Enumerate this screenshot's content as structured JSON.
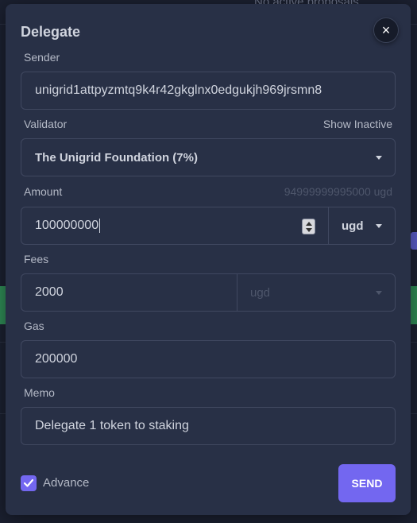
{
  "background": {
    "proposals_text": "No active proposals"
  },
  "modal": {
    "title": "Delegate",
    "close_glyph": "×",
    "sender": {
      "label": "Sender",
      "value": "unigrid1attpyzmtq9k4r42gkglnx0edgukjh969jrsmn8"
    },
    "validator": {
      "label": "Validator",
      "show_inactive": "Show Inactive",
      "selected": "The Unigrid Foundation (7%)"
    },
    "amount": {
      "label": "Amount",
      "balance": "94999999995000 ugd",
      "value": "100000000",
      "unit": "ugd"
    },
    "fees": {
      "label": "Fees",
      "value": "2000",
      "unit": "ugd"
    },
    "gas": {
      "label": "Gas",
      "value": "200000"
    },
    "memo": {
      "label": "Memo",
      "value": "Delegate 1 token to staking"
    },
    "advance": {
      "label": "Advance",
      "checked": true
    },
    "send_label": "SEND"
  },
  "colors": {
    "accent": "#7367f0",
    "modal_bg": "#283046",
    "page_bg": "#1b2030"
  },
  "icons": [
    "close-icon",
    "chevron-down-icon",
    "checkmark-icon",
    "stepper-icon"
  ]
}
